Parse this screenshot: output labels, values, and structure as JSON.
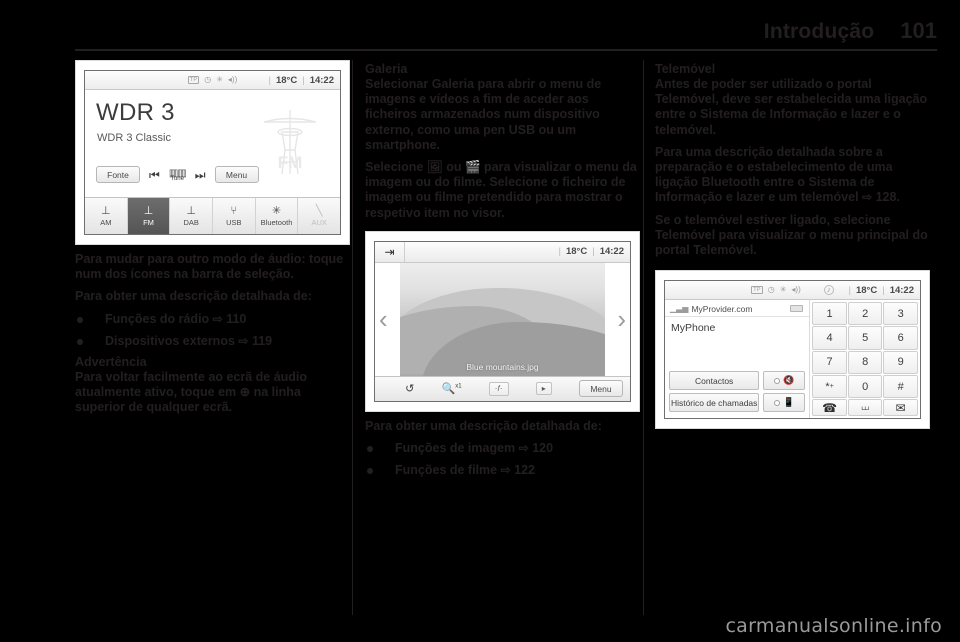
{
  "header": {
    "title": "Introdução",
    "page": "101"
  },
  "watermark": "carmanualsonline.info",
  "col1": {
    "radio_screen": {
      "status": {
        "tp": "TP",
        "icons": [
          "tp-badge-icon",
          "clock-icon",
          "bluetooth-icon",
          "speaker-icon"
        ],
        "temperature": "18°C",
        "time": "14:22",
        "separator": "|"
      },
      "station": "WDR 3",
      "station_sub": "WDR 3 Classic",
      "band_logo": "FM",
      "controls": {
        "source": "Fonte",
        "prev": "prev-track-icon",
        "tune_bars": "tune-icon",
        "tune_label": "Tune",
        "next": "next-track-icon",
        "menu": "Menu"
      },
      "sources": [
        {
          "label": "AM",
          "icon": "antenna-icon",
          "state": "normal"
        },
        {
          "label": "FM",
          "icon": "antenna-icon",
          "state": "active"
        },
        {
          "label": "DAB",
          "icon": "antenna-icon",
          "state": "normal"
        },
        {
          "label": "USB",
          "icon": "usb-icon",
          "state": "normal"
        },
        {
          "label": "Bluetooth",
          "icon": "bluetooth-icon",
          "state": "normal"
        },
        {
          "label": "AUX",
          "icon": "aux-plug-icon",
          "state": "disabled"
        }
      ]
    },
    "para1": "Para mudar para outro modo de áudio: toque num dos ícones na barra de seleção.",
    "para2": "Para obter uma descrição detalhada de:",
    "bullets": [
      {
        "text": "Funções do rádio",
        "arrow": "⇨",
        "page": "110"
      },
      {
        "text": "Dispositivos externos",
        "arrow": "⇨",
        "page": "119"
      }
    ],
    "note_title": "Advertência",
    "note_text_a": "Para voltar facilmente ao ecrã de áudio atualmente ativo, toque em",
    "note_icon": "⊕",
    "note_text_b": "na linha superior de qualquer ecrã."
  },
  "col2": {
    "heading": "Galeria",
    "para1": "Selecionar Galeria para abrir o menu de imagens e vídeos a fim de aceder aos ficheiros armazenados num dispositivo externo, como uma pen USB ou um smartphone.",
    "para2_a": "Selecione",
    "para2_icon1": "🖼",
    "para2_b": "ou",
    "para2_icon2": "🎬",
    "para2_c": "para visualizar o menu da imagem ou do filme. Selecione o ficheiro de imagem ou filme pretendido para mostrar o respetivo item no visor.",
    "gallery_screen": {
      "back_icon": "back-arrow-icon",
      "temperature": "18°C",
      "time": "14:22",
      "separator": "|",
      "caption": "Blue mountains.jpg",
      "prev_chevron": "‹",
      "next_chevron": "›",
      "toolbar": {
        "rotate": "rotate-icon",
        "zoom": "zoom-x1-icon",
        "zoom_label": "x1",
        "effects": "effects-icon",
        "slideshow": "slideshow-icon",
        "menu": "Menu"
      }
    },
    "para3": "Para obter uma descrição detalhada de:",
    "bullets": [
      {
        "text": "Funções de imagem",
        "arrow": "⇨",
        "page": "120"
      },
      {
        "text": "Funções de filme",
        "arrow": "⇨",
        "page": "122"
      }
    ]
  },
  "col3": {
    "heading": "Telemóvel",
    "para1": "Antes de poder ser utilizado o portal Telemóvel, deve ser estabelecida uma ligação entre o Sistema de Informação e lazer e o telemóvel.",
    "para2": "Para uma descrição detalhada sobre a preparação e o estabelecimento de uma ligação Bluetooth entre o Sistema de Informação e lazer e um telemóvel",
    "para2_arrow": "⇨",
    "para2_page": "128.",
    "para3": "Se o telemóvel estiver ligado, selecione Telemóvel para visualizar o menu principal do portal Telemóvel.",
    "phone_screen": {
      "status": {
        "tp": "TP",
        "icons": [
          "tp-badge-icon",
          "clock-icon",
          "bluetooth-icon",
          "speaker-icon",
          "music-note-icon"
        ],
        "temperature": "18°C",
        "time": "14:22",
        "separator": "|"
      },
      "provider": "MyProvider.com",
      "signal_icon": "signal-bars-icon",
      "battery_icon": "battery-icon",
      "phone_name": "MyPhone",
      "contacts_label": "Contactos",
      "history_label": "Histórico de chamadas",
      "mute_icon": "mic-mute-icon",
      "handset_icon": "handset-transfer-icon",
      "keys": [
        "1",
        "2",
        "3",
        "4",
        "5",
        "6",
        "7",
        "8",
        "9",
        "*",
        "0",
        "#"
      ],
      "star_sub": "+",
      "call_icon": "📞",
      "hangup_icon": "hangup-icon",
      "voicemail_icon": "voicemail-icon"
    }
  }
}
